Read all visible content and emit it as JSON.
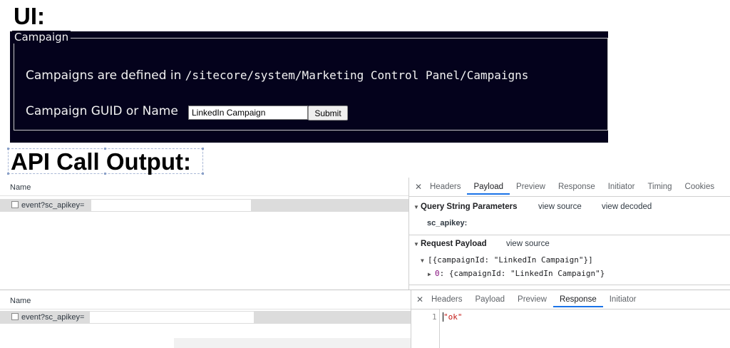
{
  "headings": {
    "ui": "UI:",
    "api_output": "API Call Output:"
  },
  "campaign_form": {
    "legend": "Campaign",
    "info_prefix": "Campaigns are defined in ",
    "info_path": "/sitecore/system/Marketing Control Panel/Campaigns",
    "guid_label": "Campaign GUID or Name",
    "input_value": "LinkedIn Campaign",
    "submit_label": "Submit",
    "panel_bg": "#04021c"
  },
  "network_top": {
    "name_header": "Name",
    "request": "event?sc_apikey=",
    "tabs": [
      "Headers",
      "Payload",
      "Preview",
      "Response",
      "Initiator",
      "Timing",
      "Cookies"
    ],
    "active_tab": "Payload",
    "query_section": {
      "title": "Query String Parameters",
      "view_source": "view source",
      "view_decoded": "view decoded",
      "key": "sc_apikey:"
    },
    "payload_section": {
      "title": "Request Payload",
      "view_source": "view source",
      "line1": "[{campaignId: \"LinkedIn Campaign\"}]",
      "line2_index": "0",
      "line2_rest": ": {campaignId: \"LinkedIn Campaign\"}"
    }
  },
  "network_bottom": {
    "name_header": "Name",
    "request": "event?sc_apikey=",
    "tabs": [
      "Headers",
      "Payload",
      "Preview",
      "Response",
      "Initiator"
    ],
    "active_tab": "Response",
    "line_number": "1",
    "response_text": "\"ok\""
  },
  "icons": {
    "close": "close-icon",
    "expand": "triangle-down-icon",
    "collapse": "triangle-right-icon"
  },
  "colors": {
    "active_tab_underline": "#1a73e8",
    "string_red": "#c41a16",
    "index_purple": "#881280"
  }
}
